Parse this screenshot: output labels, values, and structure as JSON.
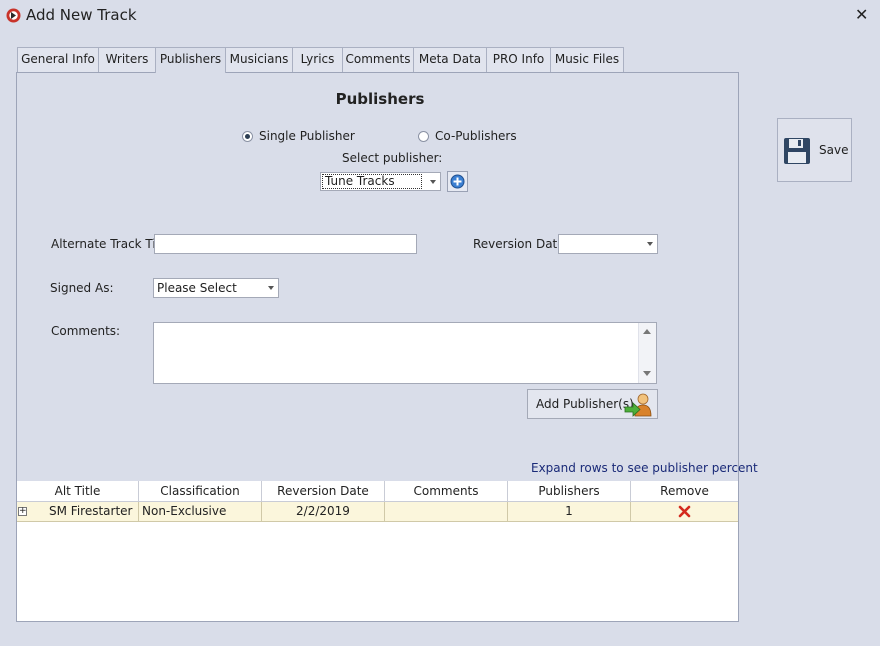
{
  "window": {
    "title": "Add New Track"
  },
  "tabs": [
    {
      "label": "General Info"
    },
    {
      "label": "Writers"
    },
    {
      "label": "Publishers"
    },
    {
      "label": "Musicians"
    },
    {
      "label": "Lyrics"
    },
    {
      "label": "Comments"
    },
    {
      "label": "Meta Data"
    },
    {
      "label": "PRO Info"
    },
    {
      "label": "Music Files"
    }
  ],
  "section": {
    "title": "Publishers"
  },
  "publisher_mode": {
    "single_label": "Single Publisher",
    "co_label": "Co-Publishers",
    "selected": "single"
  },
  "select_publisher": {
    "label": "Select publisher:",
    "value": "Tune Tracks"
  },
  "form": {
    "alt_title_label": "Alternate Track Title:",
    "alt_title_value": "",
    "reversion_date_label": "Reversion Date:",
    "reversion_date_value": "",
    "signed_as_label": "Signed As:",
    "signed_as_value": "Please Select",
    "comments_label": "Comments:",
    "comments_value": ""
  },
  "buttons": {
    "add_publishers": "Add Publisher(s)",
    "save": "Save"
  },
  "grid": {
    "hint": "Expand rows to see publisher percent",
    "columns": [
      "Alt Title",
      "Classification",
      "Reversion Date",
      "Comments",
      "Publishers",
      "Remove"
    ],
    "rows": [
      {
        "expand": "+",
        "alt_title": "SM Firestarter",
        "classification": "Non-Exclusive",
        "reversion_date": "2/2/2019",
        "comments": "",
        "publishers": "1"
      }
    ]
  }
}
